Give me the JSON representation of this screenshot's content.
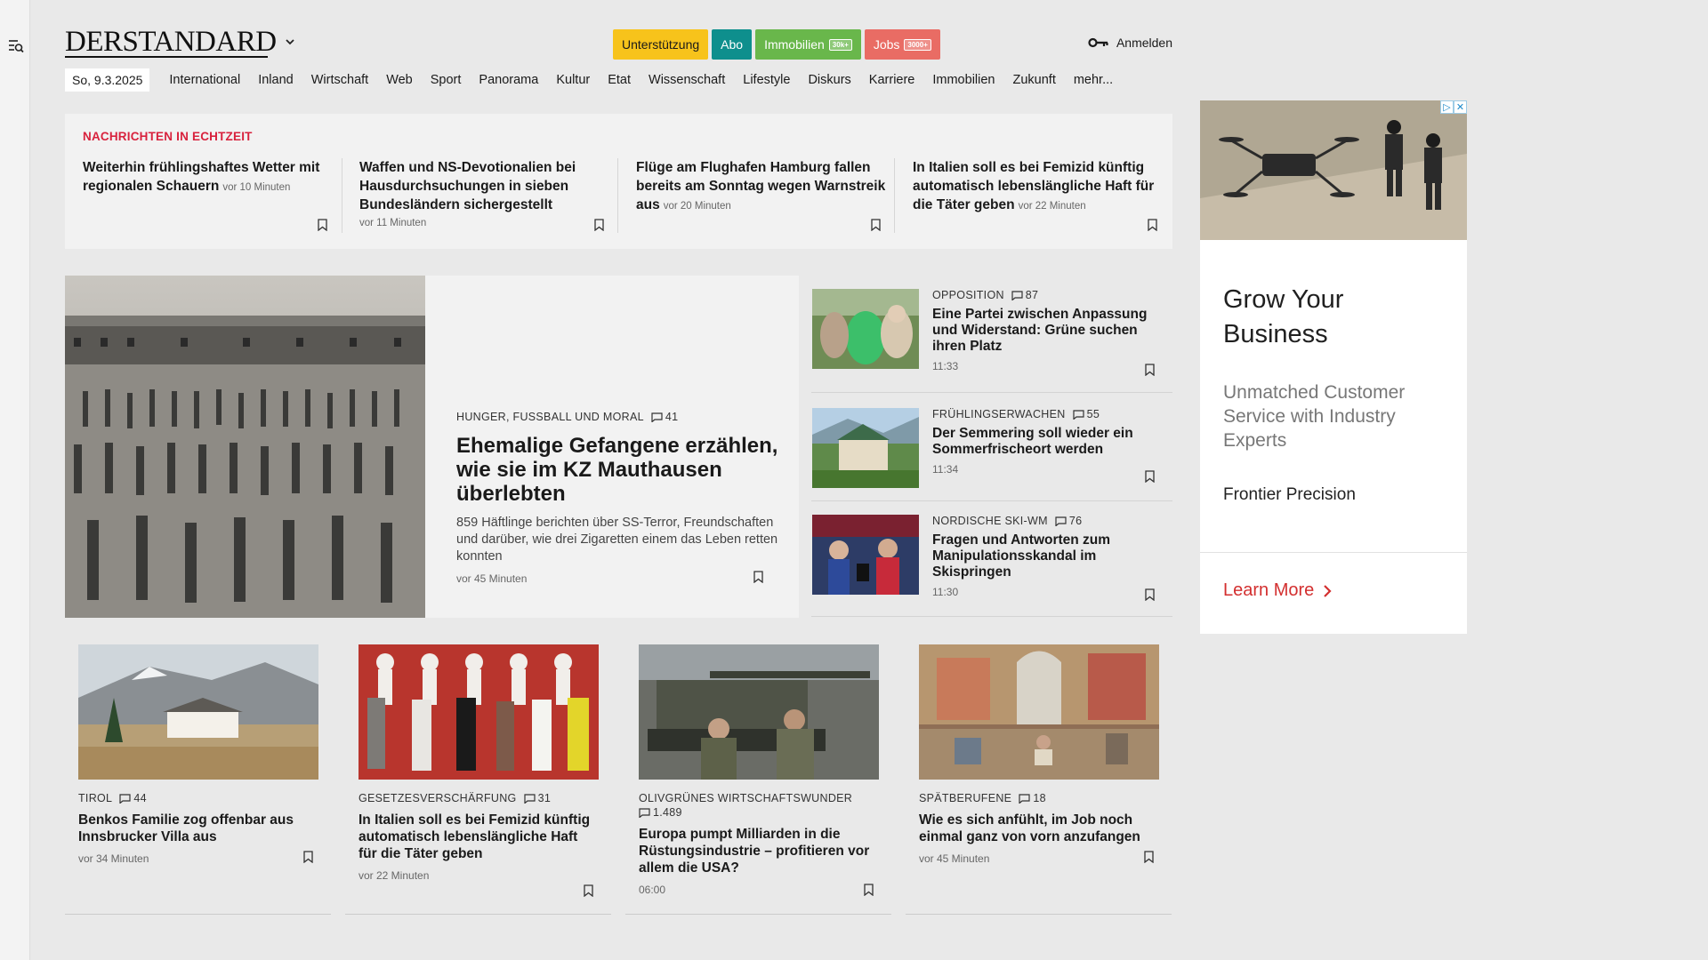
{
  "header": {
    "logo": "DERSTANDARD",
    "buttons": {
      "support": "Unterstützung",
      "abo": "Abo",
      "immobilien": "Immobilien",
      "immobilien_badge": "30k+",
      "jobs": "Jobs",
      "jobs_badge": "3000+"
    },
    "login": "Anmelden"
  },
  "nav": {
    "date": "So, 9.3.2025",
    "items": [
      "International",
      "Inland",
      "Wirtschaft",
      "Web",
      "Sport",
      "Panorama",
      "Kultur",
      "Etat",
      "Wissenschaft",
      "Lifestyle",
      "Diskurs",
      "Karriere",
      "Immobilien",
      "Zukunft",
      "mehr..."
    ]
  },
  "live": {
    "label": "NACHRICHTEN IN ECHTZEIT",
    "items": [
      {
        "title": "Weiterhin frühlingshaftes Wetter mit regionalen Schauern",
        "time": "vor 10 Minuten"
      },
      {
        "title": "Waffen und NS-Devotionalien bei Hausdurchsuchungen in sieben Bundesländern sichergestellt",
        "time": "vor 11 Minuten"
      },
      {
        "title": "Flüge am Flughafen Hamburg fallen bereits am Sonntag wegen Warnstreik aus",
        "time": "vor 20 Minuten"
      },
      {
        "title": "In Italien soll es bei Femizid künftig automatisch lebenslängliche Haft für die Täter geben",
        "time": "vor 22 Minuten"
      }
    ]
  },
  "lead": {
    "kicker": "HUNGER, FUSSBALL UND MORAL",
    "comments": "41",
    "title": "Ehemalige Gefangene erzählen, wie sie im KZ Mauthausen überlebten",
    "teaser": "859 Häftlinge berichten über SS-Terror, Freundschaften und darüber, wie drei Zigaretten einem das Leben retten konnten",
    "time": "vor 45 Minuten"
  },
  "side": [
    {
      "kicker": "OPPOSITION",
      "comments": "87",
      "title": "Eine Partei zwischen Anpassung und Widerstand: Grüne suchen ihren Platz",
      "time": "11:33"
    },
    {
      "kicker": "FRÜHLINGSERWACHEN",
      "comments": "55",
      "title": "Der Semmering soll wieder ein Sommerfrischeort werden",
      "time": "11:34"
    },
    {
      "kicker": "NORDISCHE SKI-WM",
      "comments": "76",
      "title": "Fragen und Antworten zum Manipulationsskandal im Skispringen",
      "time": "11:30"
    }
  ],
  "grid": [
    {
      "kicker": "TIROL",
      "comments": "44",
      "title": "Benkos Familie zog offenbar aus Innsbrucker Villa aus",
      "time": "vor 34 Minuten"
    },
    {
      "kicker": "GESETZESVERSCHÄRFUNG",
      "comments": "31",
      "title": "In Italien soll es bei Femizid künftig automatisch lebenslängliche Haft für die Täter geben",
      "time": "vor 22 Minuten"
    },
    {
      "kicker": "OLIVGRÜNES WIRTSCHAFTSWUNDER",
      "comments": "1.489",
      "title": "Europa pumpt Milliarden in die Rüstungsindustrie – profitieren vor allem die USA?",
      "time": "06:00"
    },
    {
      "kicker": "SPÄTBERUFENE",
      "comments": "18",
      "title": "Wie es sich anfühlt, im Job noch einmal ganz von vorn anzufangen",
      "time": "vor 45 Minuten"
    }
  ],
  "ad": {
    "headline": "Grow Your Business",
    "sub": "Unmatched Customer Service with Industry Experts",
    "brand": "Frontier Precision",
    "cta": "Learn More"
  },
  "colors": {
    "live_label": "#d8223d",
    "support": "#f7c31b",
    "abo": "#0e8f8d",
    "immobilien": "#69b74b",
    "jobs": "#e96c64",
    "ad_cta": "#d32f2f"
  }
}
